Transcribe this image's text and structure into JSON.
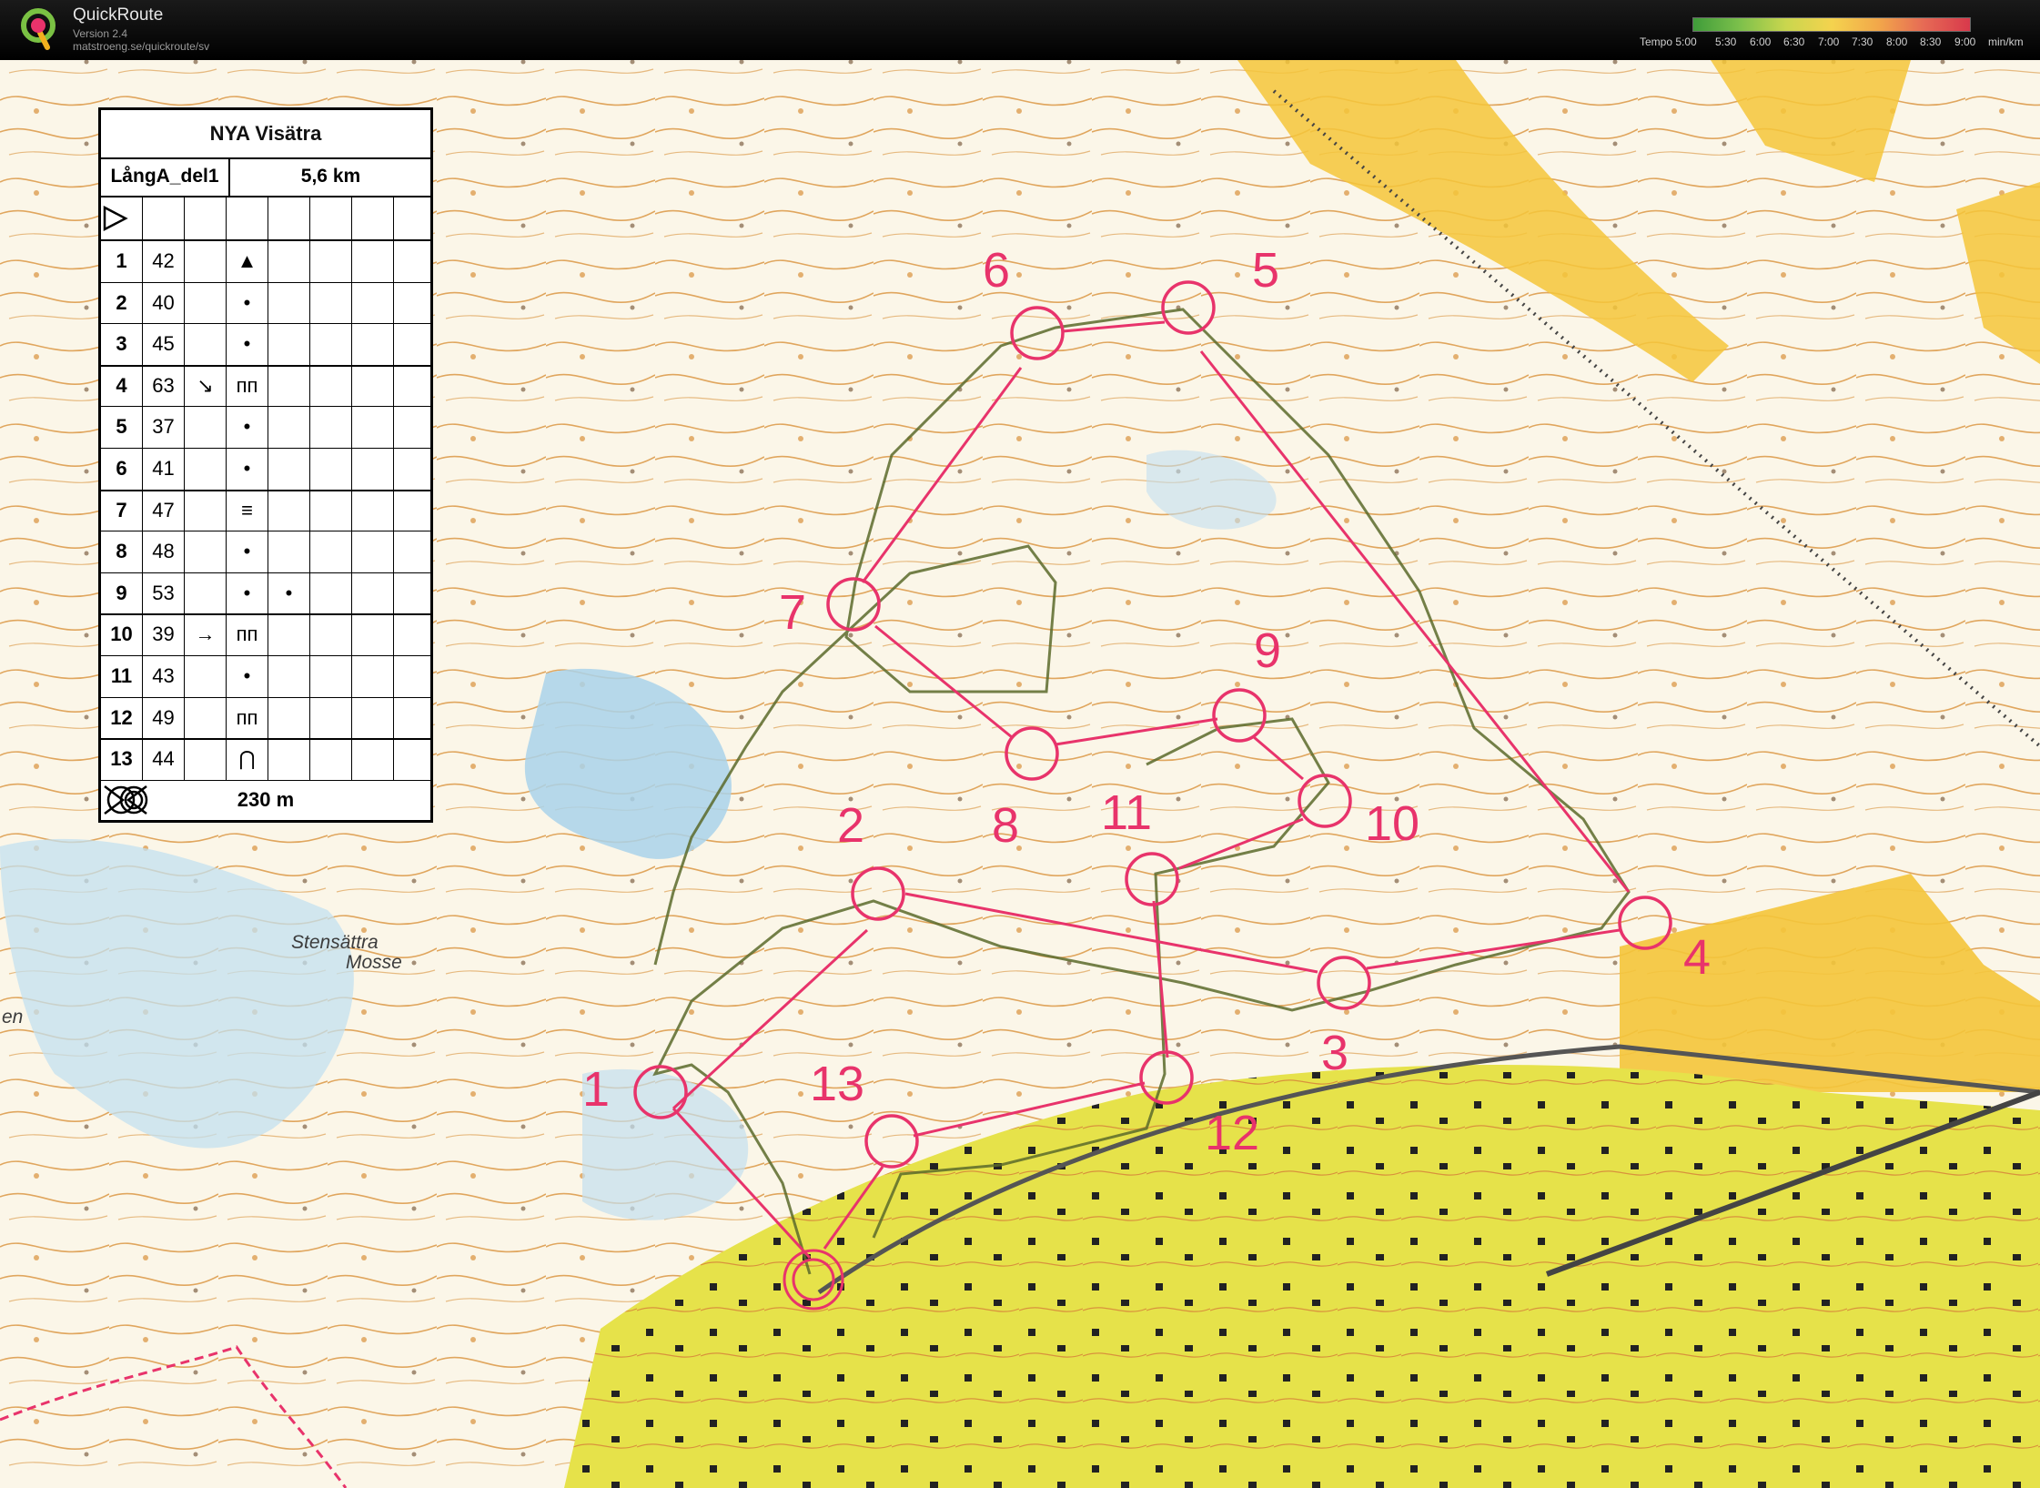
{
  "app": {
    "name": "QuickRoute",
    "version": "Version 2.4",
    "url": "matstroeng.se/quickroute/sv",
    "logo_letter": "Q"
  },
  "tempo_legend": {
    "labels": [
      "Tempo 5:00",
      "5:30",
      "6:00",
      "6:30",
      "7:00",
      "7:30",
      "8:00",
      "8:30",
      "9:00",
      "min/km"
    ]
  },
  "description": {
    "event": "NYA Visätra",
    "course": "LångA_del1",
    "length": "5,6 km",
    "start_symbol": "triangle",
    "controls": [
      {
        "n": "1",
        "code": "42",
        "feature": "▲"
      },
      {
        "n": "2",
        "code": "40",
        "feature": "•"
      },
      {
        "n": "3",
        "code": "45",
        "feature": "•"
      },
      {
        "n": "4",
        "code": "63",
        "dir": "↘",
        "feature": "ᴨᴨ"
      },
      {
        "n": "5",
        "code": "37",
        "feature": "•"
      },
      {
        "n": "6",
        "code": "41",
        "feature": "•"
      },
      {
        "n": "7",
        "code": "47",
        "feature": "≡"
      },
      {
        "n": "8",
        "code": "48",
        "feature": "•"
      },
      {
        "n": "9",
        "code": "53",
        "feature": "•",
        "extra": "•"
      },
      {
        "n": "10",
        "code": "39",
        "dir": "→",
        "feature": "ᴨᴨ"
      },
      {
        "n": "11",
        "code": "43",
        "feature": "•"
      },
      {
        "n": "12",
        "code": "49",
        "feature": "ᴨᴨ"
      },
      {
        "n": "13",
        "code": "44",
        "feature": "⋂"
      }
    ],
    "finish_distance": "230 m"
  },
  "map": {
    "place_labels": [
      "Stensättra",
      "Mosse",
      "en"
    ],
    "control_labels": [
      "1",
      "2",
      "3",
      "4",
      "5",
      "6",
      "7",
      "8",
      "9",
      "10",
      "11",
      "12",
      "13"
    ],
    "colors": {
      "course": "#e8336b",
      "route": "#5a6a2a",
      "paper": "#fbf6e8",
      "open_yellow": "#f4c53a",
      "urban": "#e6e24a",
      "water": "#a9d2ea",
      "contour": "#d9923c"
    }
  }
}
